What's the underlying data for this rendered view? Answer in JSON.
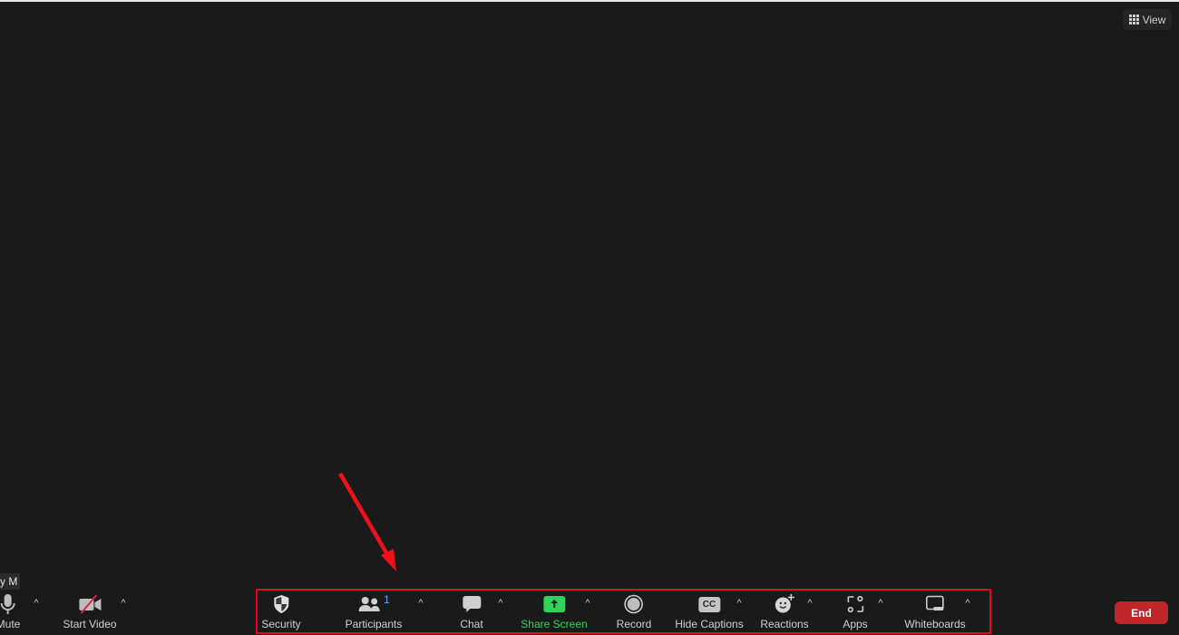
{
  "view_button": {
    "label": "View",
    "icon": "grid-icon"
  },
  "name_tag": "y M",
  "toolbar": {
    "items": [
      {
        "label": "Mute",
        "icon": "microphone-icon"
      },
      {
        "label": "Start Video",
        "icon": "video-off-icon"
      },
      {
        "label": "Security",
        "icon": "shield-icon"
      },
      {
        "label": "Participants",
        "icon": "participants-icon",
        "count": "1"
      },
      {
        "label": "Chat",
        "icon": "chat-icon"
      },
      {
        "label": "Share Screen",
        "icon": "share-screen-icon"
      },
      {
        "label": "Record",
        "icon": "record-icon"
      },
      {
        "label": "Hide Captions",
        "icon": "cc-icon",
        "icon_text": "CC"
      },
      {
        "label": "Reactions",
        "icon": "reaction-icon"
      },
      {
        "label": "Apps",
        "icon": "apps-icon"
      },
      {
        "label": "Whiteboards",
        "icon": "whiteboard-icon"
      }
    ],
    "caret": "^",
    "end_label": "End"
  },
  "colors": {
    "background": "#1a1a1a",
    "share_green": "#2fd35a",
    "end_red": "#c0262a",
    "annotation_red": "#e8001c"
  }
}
